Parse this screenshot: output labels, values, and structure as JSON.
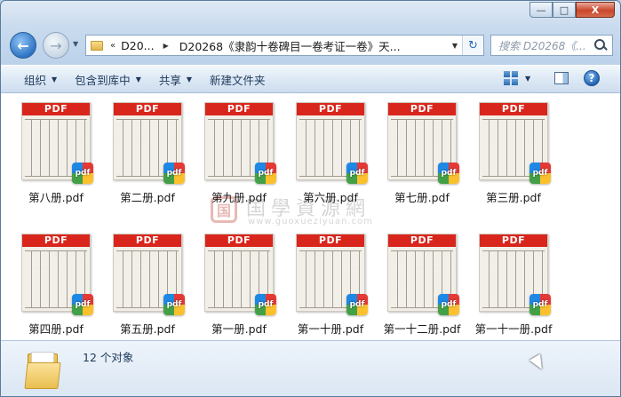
{
  "window": {
    "caption_buttons": {
      "minimize": "—",
      "maximize": "□",
      "close": "X"
    }
  },
  "nav": {
    "back_glyph": "←",
    "forward_glyph": "→",
    "history_glyph": "▼",
    "address": {
      "chevrons": "«",
      "crumb1": "D20...",
      "separator": "▶",
      "crumb2": "D20268《隶韵十卷碑目一卷考证一卷》天...",
      "dropdown": "▼",
      "refresh": "↻"
    },
    "search_placeholder": "搜索 D20268《..."
  },
  "toolbar": {
    "organize": "组织",
    "include_in_library": "包含到库中",
    "share": "共享",
    "new_folder": "新建文件夹",
    "arrow": "▼",
    "help": "?"
  },
  "files": [
    {
      "name": "第八册.pdf"
    },
    {
      "name": "第二册.pdf"
    },
    {
      "name": "第九册.pdf"
    },
    {
      "name": "第六册.pdf"
    },
    {
      "name": "第七册.pdf"
    },
    {
      "name": "第三册.pdf"
    },
    {
      "name": "第四册.pdf"
    },
    {
      "name": "第五册.pdf"
    },
    {
      "name": "第一册.pdf"
    },
    {
      "name": "第一十册.pdf"
    },
    {
      "name": "第一十二册.pdf"
    },
    {
      "name": "第一十一册.pdf"
    }
  ],
  "thumb": {
    "banner": "PDF",
    "badge": "pdf"
  },
  "watermark": {
    "logo": "国",
    "title": "国學資源網",
    "url": "www.guoxueziyuan.com"
  },
  "details": {
    "count_text": "12 个对象"
  },
  "colors": {
    "accent": "#d9261c",
    "text": "#1e395b",
    "window_frame": "#b9d1ea"
  }
}
